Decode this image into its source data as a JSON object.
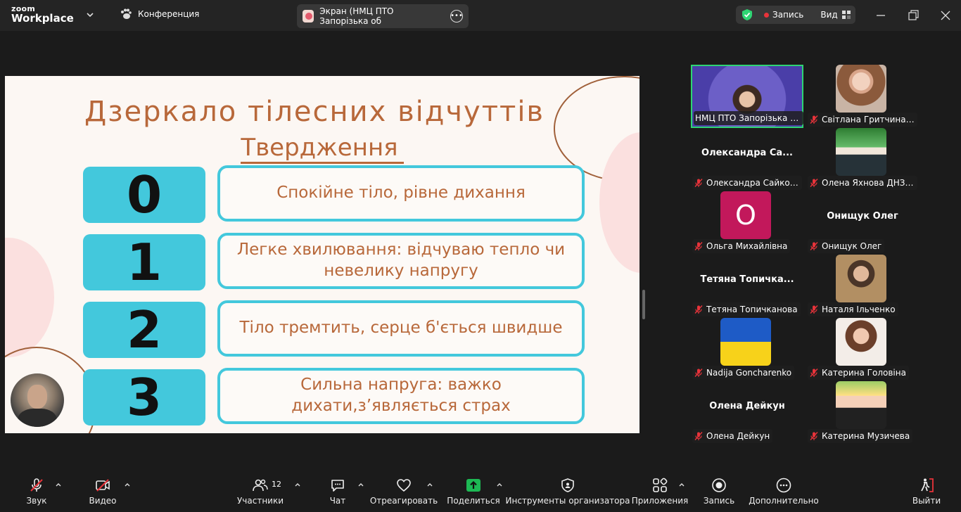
{
  "titlebar": {
    "logo_top": "zoom",
    "logo_bottom": "Workplace",
    "conference_tab": "Конференция",
    "screen_tab": "Экран (НМЦ ПТО Запорізька об",
    "recording": "Запись",
    "view": "Вид"
  },
  "slide": {
    "title": "Дзеркало тілесних відчуттів",
    "subtitle": "Твердження",
    "rows": [
      {
        "num": "0",
        "text": "Спокійне тіло, рівне дихання"
      },
      {
        "num": "1",
        "text": "Легке хвилювання: відчуваю тепло чи невелику напругу"
      },
      {
        "num": "2",
        "text": "Тіло тремтить, серце б'ється швидше"
      },
      {
        "num": "3",
        "text": "Сильна напруга: важко дихати,з’являється страх"
      }
    ]
  },
  "participants": [
    {
      "label": "НМЦ ПТО Запорізька о...",
      "type": "active"
    },
    {
      "label": "Світлана Гритчина Н...",
      "type": "photo"
    },
    {
      "label": "Олександра Сайковс...",
      "big": "Олександра  Са...",
      "type": "name"
    },
    {
      "label": "Олена Яхнова ДНЗ З...",
      "type": "photo"
    },
    {
      "label": "Ольга Михайлівна",
      "letter": "О",
      "type": "letter"
    },
    {
      "label": "Онищук Олег",
      "big": "Онищук Олег",
      "type": "name"
    },
    {
      "label": "Тетяна Топичканова",
      "big": "Тетяна  Топичка...",
      "type": "name"
    },
    {
      "label": "Наталя Ільченко",
      "type": "photo"
    },
    {
      "label": "Nadija Goncharenko",
      "type": "flag"
    },
    {
      "label": "Катерина Головіна",
      "type": "photo"
    },
    {
      "label": "Олена Дейкун",
      "big": "Олена Дейкун",
      "type": "name"
    },
    {
      "label": "Катерина Музичева",
      "type": "photo"
    }
  ],
  "toolbar": {
    "audio": "Звук",
    "video": "Видео",
    "participants": "Участники",
    "participants_count": "12",
    "chat": "Чат",
    "react": "Отреагировать",
    "share": "Поделиться",
    "host_tools": "Инструменты организатора",
    "apps": "Приложения",
    "record": "Запись",
    "more": "Дополнительно",
    "leave": "Выйти"
  },
  "colors": {
    "accent_green": "#2ed573",
    "share_green": "#1db954",
    "slide_cyan": "#43c8dc",
    "slide_brown": "#b8683a",
    "mic_off_red": "#e8333a"
  }
}
